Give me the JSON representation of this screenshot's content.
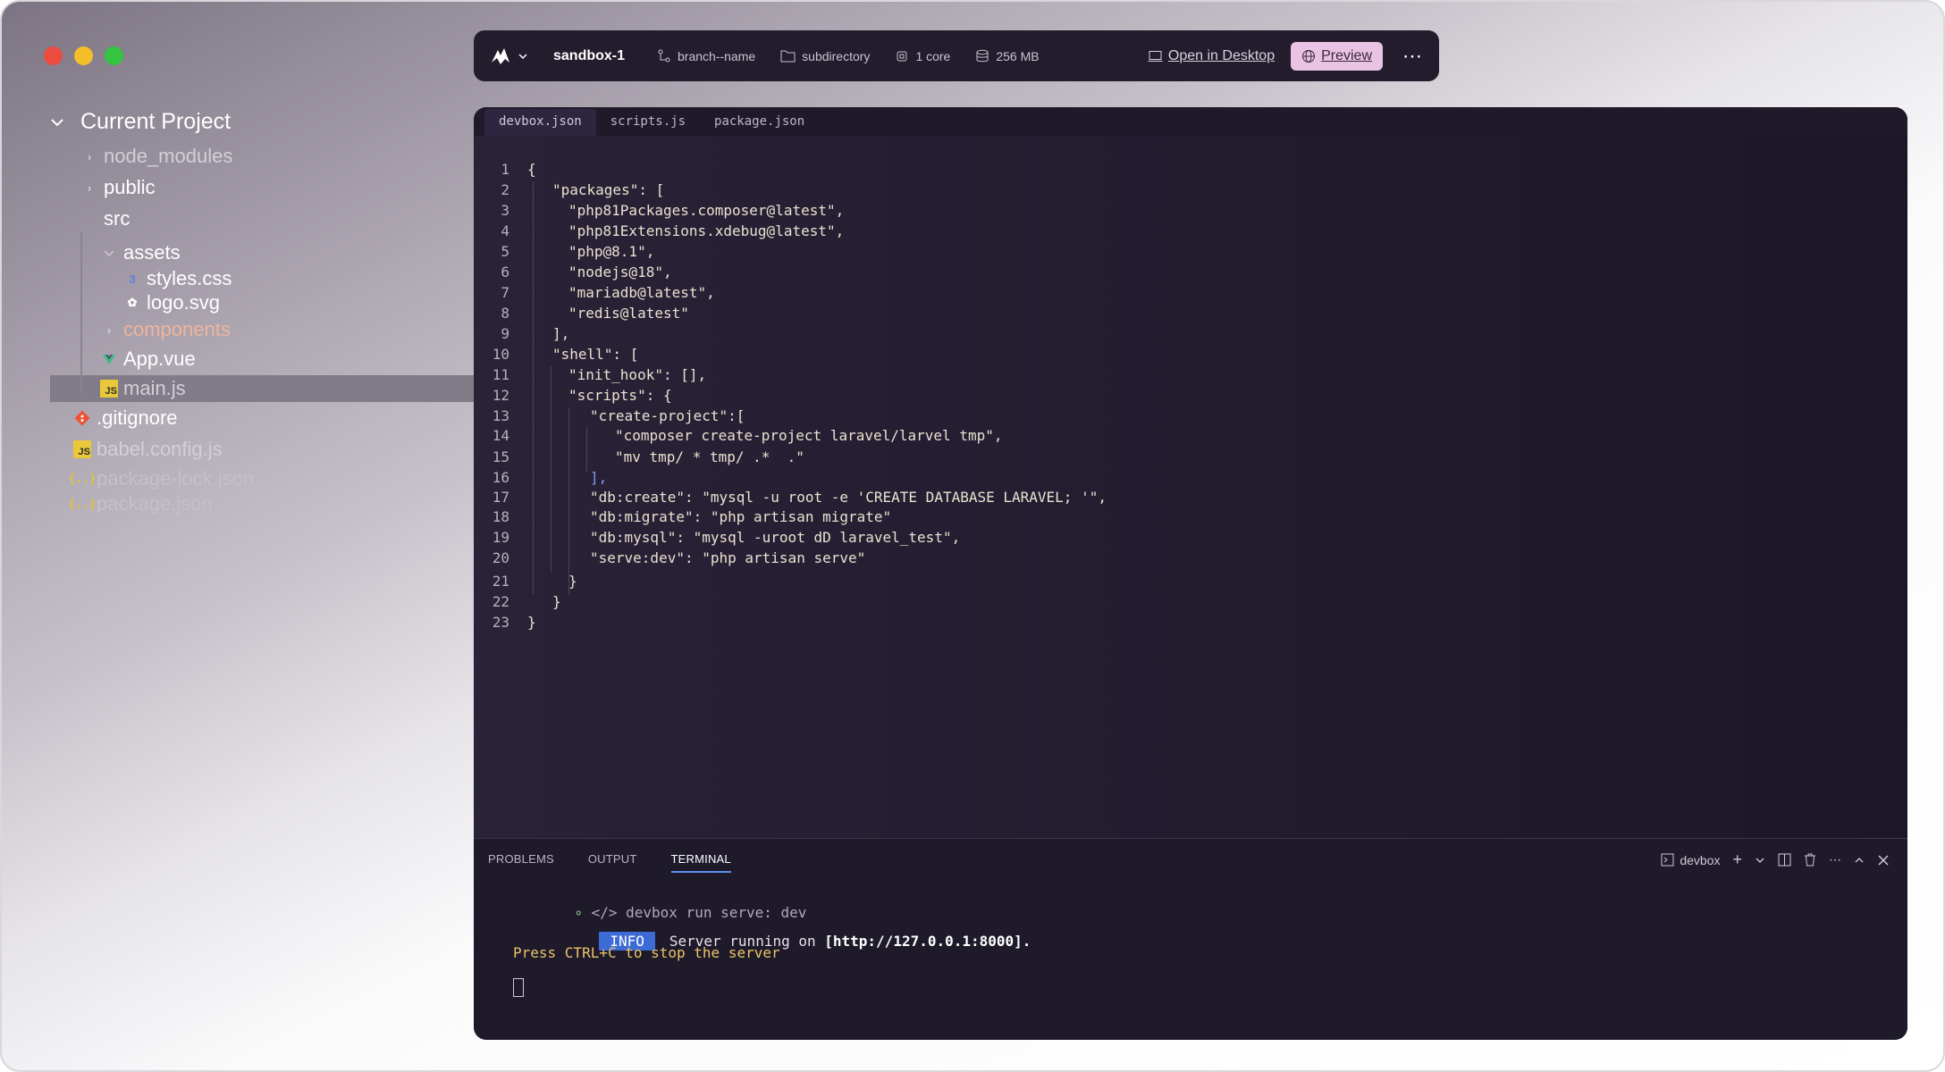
{
  "window": {
    "controls": [
      "close",
      "minimize",
      "maximize"
    ]
  },
  "sidebar": {
    "title": "Current Project",
    "items": [
      {
        "label": "node_modules",
        "icon": "chevron-right-icon"
      },
      {
        "label": "public",
        "icon": "chevron-right-icon"
      },
      {
        "label": "src",
        "icon": "chevron-down-icon"
      },
      {
        "label": "assets",
        "icon": "chevron-down-icon"
      },
      {
        "label": "styles.css",
        "icon": "css-file-icon"
      },
      {
        "label": "logo.svg",
        "icon": "svg-file-icon"
      },
      {
        "label": "components",
        "icon": "chevron-right-icon"
      },
      {
        "label": "App.vue",
        "icon": "vue-file-icon"
      },
      {
        "label": "main.js",
        "icon": "js-file-icon"
      },
      {
        "label": ".gitignore",
        "icon": "git-icon"
      },
      {
        "label": "babel.config.js",
        "icon": "js-file-icon"
      },
      {
        "label": "package-lock.json",
        "icon": "json-file-icon"
      },
      {
        "label": "package.json",
        "icon": "json-file-icon"
      }
    ],
    "icon_text": {
      "js": "JS",
      "json": "{..}"
    }
  },
  "toolbar": {
    "sandbox": "sandbox-1",
    "branch": "branch--name",
    "directory": "subdirectory",
    "cpu": "1 core",
    "memory": "256 MB",
    "open_desktop": "Open in Desktop",
    "preview": "Preview"
  },
  "editor": {
    "tabs": [
      "devbox.json",
      "scripts.js",
      "package.json"
    ],
    "lines": [
      "{",
      "\"packages\": [",
      "\"php81Packages.composer@latest\",",
      "\"php81Extensions.xdebug@latest\",",
      "\"php@8.1\",",
      "\"nodejs@18\",",
      "\"mariadb@latest\",",
      "\"redis@latest\"",
      "],",
      "\"shell\": [",
      "\"init_hook\": [],",
      "\"scripts\": {",
      "\"create-project\":[",
      "\"composer create-project laravel/larvel tmp\",",
      "\"mv tmp/ * tmp/ .*  .\"",
      "],",
      "\"db:create\": \"mysql -u root -e 'CREATE DATABASE LARAVEL; '\",",
      "\"db:migrate\": \"php artisan migrate\"",
      "\"db:mysql\": \"mysql -uroot dD laravel_test\",",
      "\"serve:dev\": \"php artisan serve\"",
      "}",
      "}",
      "}"
    ]
  },
  "panel": {
    "tabs": [
      "PROBLEMS",
      "OUTPUT",
      "TERMINAL"
    ],
    "active_tab": "TERMINAL",
    "terminal_name": "devbox",
    "terminal": {
      "command": "</> devbox run serve: dev",
      "info_badge": "INFO",
      "server_text": "Server running on ",
      "server_url": "[http://127.0.0.1:8000].",
      "stop_hint": "Press CTRL+C to stop the server"
    }
  },
  "colors": {
    "accent": "#5b8ef0",
    "preview": "#e9c3e4",
    "editor_bg": "#221c2f",
    "info": "#3d6bd6"
  }
}
